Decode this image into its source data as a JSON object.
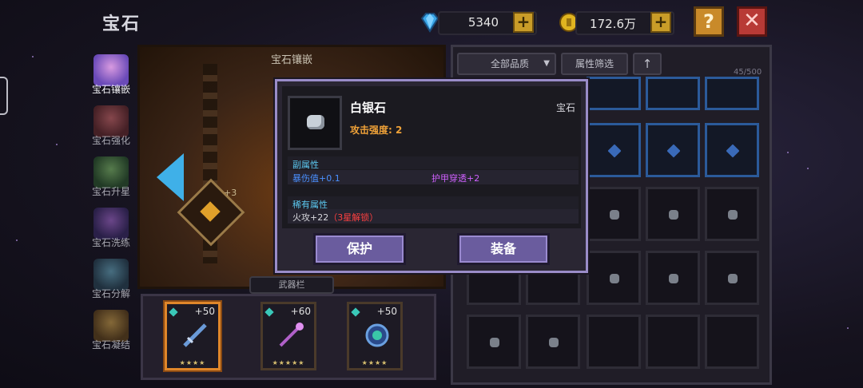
{
  "header": {
    "title": "宝石"
  },
  "resources": {
    "diamonds": {
      "value": "5340",
      "icon": "diamond-icon",
      "add_label": "+"
    },
    "gold": {
      "value": "172.6万",
      "icon": "gold-coin-icon",
      "add_label": "+"
    }
  },
  "buttons": {
    "help_label": "?",
    "close_label": "✕"
  },
  "sidebar": {
    "items": [
      {
        "label": "宝石镶嵌",
        "icon": "gem-inlay-icon",
        "active": true
      },
      {
        "label": "宝石强化",
        "icon": "gem-enhance-icon",
        "active": false
      },
      {
        "label": "宝石升星",
        "icon": "gem-star-icon",
        "active": false
      },
      {
        "label": "宝石洗练",
        "icon": "gem-refine-icon",
        "active": false
      },
      {
        "label": "宝石分解",
        "icon": "gem-decompose-icon",
        "active": false
      },
      {
        "label": "宝石凝结",
        "icon": "gem-condense-icon",
        "active": false
      }
    ]
  },
  "inlay_panel": {
    "title": "宝石镶嵌",
    "slot_level": "+3",
    "weapon_tab_label": "武器栏"
  },
  "weapons": [
    {
      "level": "+50",
      "stars": "★★★★",
      "selected": true,
      "color": "#4a7ab8"
    },
    {
      "level": "+60",
      "stars": "★★★★★",
      "selected": false,
      "color": "#b060c8"
    },
    {
      "level": "+50",
      "stars": "★★★★",
      "selected": false,
      "color": "#2a8ad0"
    }
  ],
  "inventory": {
    "quality_filter": "全部品质",
    "attr_filter": "属性筛选",
    "sort_icon": "up-arrow-icon",
    "count": "45/500"
  },
  "popup": {
    "item_name": "白银石",
    "item_type": "宝石",
    "attack": "攻击强度: 2",
    "sub_title": "副属性",
    "sub_attr_1": "暴伤值+0.1",
    "sub_attr_2": "护甲穿透+2",
    "rare_title": "稀有属性",
    "rare_attr": "火攻+22",
    "rare_lock": "（3星解锁）",
    "protect_label": "保护",
    "equip_label": "装备"
  },
  "colors": {
    "accent_blue": "#3fb0e8",
    "attack_orange": "#f0a238",
    "sub_blue": "#4a90ff",
    "sub_purple": "#d060ff",
    "lock_red": "#ff4040"
  }
}
